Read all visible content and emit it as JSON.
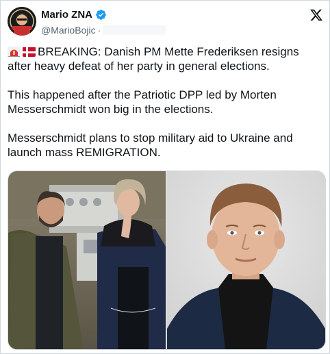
{
  "author": {
    "name": "Mario ZNA",
    "handle": "@MarioBojic",
    "separator": "·",
    "avatar_icon": "profile-avatar",
    "verified_icon": "verified-badge-icon",
    "verified_color": "#1d9bf0"
  },
  "platform_icon": "x-logo-icon",
  "tweet": {
    "line1_emojis": [
      "rotating-light-emoji",
      "denmark-flag-emoji"
    ],
    "paragraphs": [
      [
        "BREAKING: Danish PM Mette Frederiksen resigns",
        "after heavy defeat of her party in general elections."
      ],
      [
        "This happened after the Patriotic DPP led by Morten",
        "Messerschmidt won big in the elections."
      ],
      [
        "Messerschmidt plans to stop military aid to Ukraine and",
        "launch mass REMIGRATION."
      ]
    ]
  },
  "media": {
    "images": [
      {
        "name": "photo-zelensky-frederiksen"
      },
      {
        "name": "photo-messerschmidt-portrait"
      }
    ]
  },
  "colors": {
    "text": "#0f1419",
    "secondary_text": "#536471",
    "border": "#cfd9de"
  }
}
